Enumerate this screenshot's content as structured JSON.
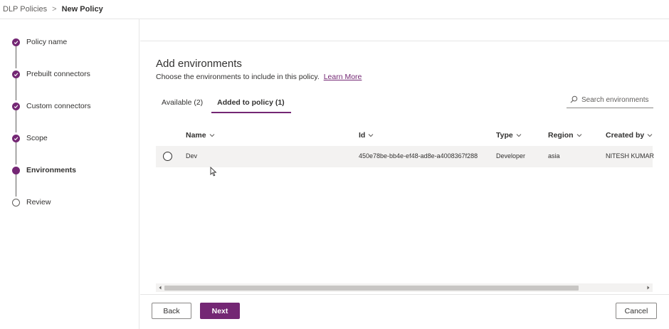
{
  "breadcrumb": {
    "parent": "DLP Policies",
    "separator": ">",
    "current": "New Policy"
  },
  "steps": [
    {
      "label": "Policy name",
      "state": "completed"
    },
    {
      "label": "Prebuilt connectors",
      "state": "completed"
    },
    {
      "label": "Custom connectors",
      "state": "completed"
    },
    {
      "label": "Scope",
      "state": "completed"
    },
    {
      "label": "Environments",
      "state": "current"
    },
    {
      "label": "Review",
      "state": "pending"
    }
  ],
  "main": {
    "title": "Add environments",
    "subtitle": "Choose the environments to include in this policy.",
    "learn_more": "Learn More",
    "tabs": [
      {
        "label": "Available (2)",
        "active": false
      },
      {
        "label": "Added to policy (1)",
        "active": true
      }
    ],
    "search": {
      "placeholder": "Search environments",
      "icon": "search-icon"
    }
  },
  "table": {
    "columns": [
      "Name",
      "Id",
      "Type",
      "Region",
      "Created by"
    ],
    "rows": [
      {
        "name": "Dev",
        "id": "450e78be-bb4e-ef48-ad8e-a4008367f288",
        "type": "Developer",
        "region": "asia",
        "created_by": "NITESH KUMAR"
      }
    ]
  },
  "footer": {
    "back_label": "Back",
    "next_label": "Next",
    "cancel_label": "Cancel"
  },
  "colors": {
    "accent": "#742774",
    "row_selected_bg": "#f3f2f1",
    "text": "#323130"
  }
}
